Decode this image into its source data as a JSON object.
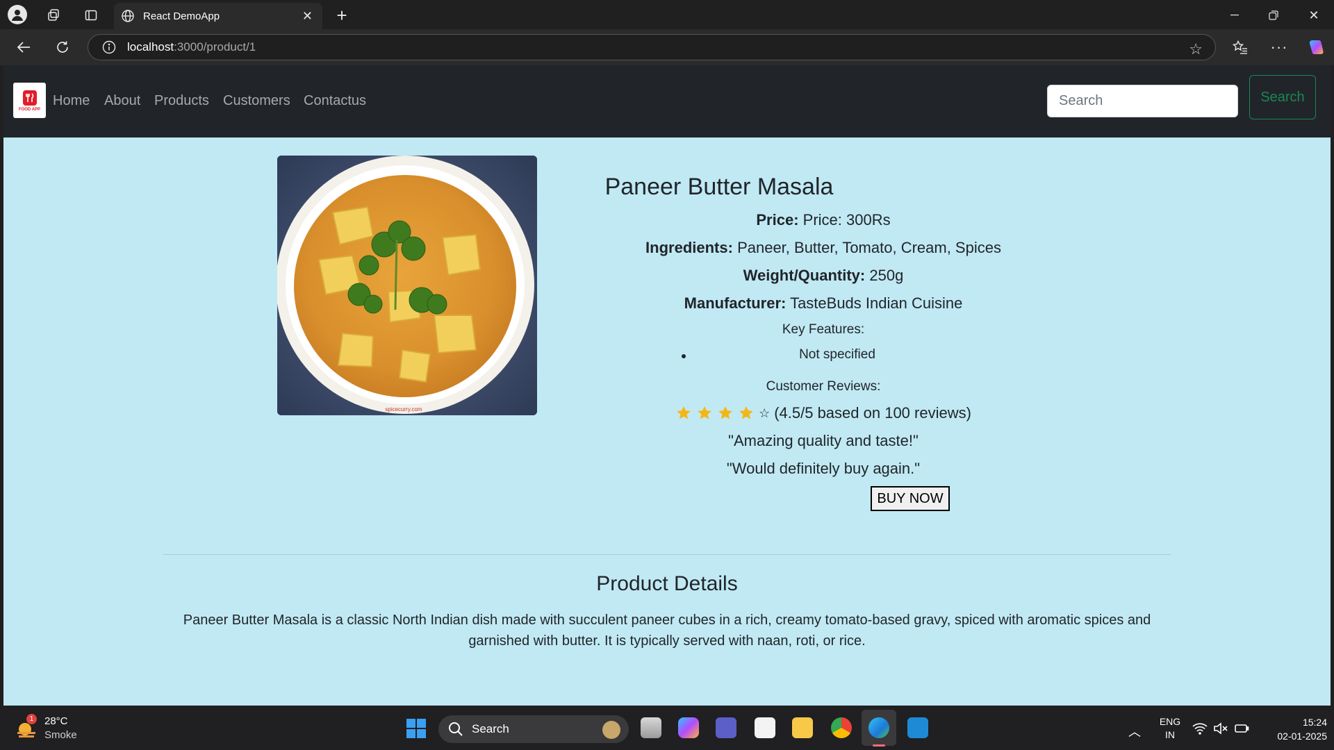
{
  "browser": {
    "tab_title": "React DemoApp",
    "url_host": "localhost",
    "url_path": ":3000/product/1"
  },
  "navbar": {
    "brand": "FOOD APP",
    "links": [
      "Home",
      "About",
      "Products",
      "Customers",
      "Contactus"
    ],
    "search_placeholder": "Search",
    "search_button": "Search"
  },
  "product": {
    "name": "Paneer Butter Masala",
    "price_label": "Price:",
    "price_value": "Price: 300Rs",
    "ingredients_label": "Ingredients:",
    "ingredients_value": "Paneer, Butter, Tomato, Cream, Spices",
    "weight_label": "Weight/Quantity:",
    "weight_value": "250g",
    "manufacturer_label": "Manufacturer:",
    "manufacturer_value": "TasteBuds Indian Cuisine",
    "key_features_heading": "Key Features:",
    "key_features": [
      "Not specified"
    ],
    "reviews_heading": "Customer Reviews:",
    "rating_value": 4.5,
    "rating_text": "(4.5/5 based on 100 reviews)",
    "reviews": [
      "\"Amazing quality and taste!\"",
      "\"Would definitely buy again.\""
    ],
    "buy_button": "BUY NOW",
    "image_caption": "spicecurry.com"
  },
  "details": {
    "heading": "Product Details",
    "line1": "Paneer Butter Masala is a classic North Indian dish made with succulent paneer cubes in a rich, creamy tomato-based gravy, spiced with aromatic spices and",
    "line2": "garnished with butter. It is typically served with naan, roti, or rice."
  },
  "taskbar": {
    "weather_temp": "28°C",
    "weather_desc": "Smoke",
    "weather_badge": "1",
    "search_label": "Search",
    "lang": "ENG",
    "region": "IN",
    "time": "15:24",
    "date": "02-01-2025"
  },
  "colors": {
    "page_bg": "#c0e9f4",
    "navbar_bg": "#212529",
    "accent_green": "#198754",
    "star": "#f5b614"
  }
}
